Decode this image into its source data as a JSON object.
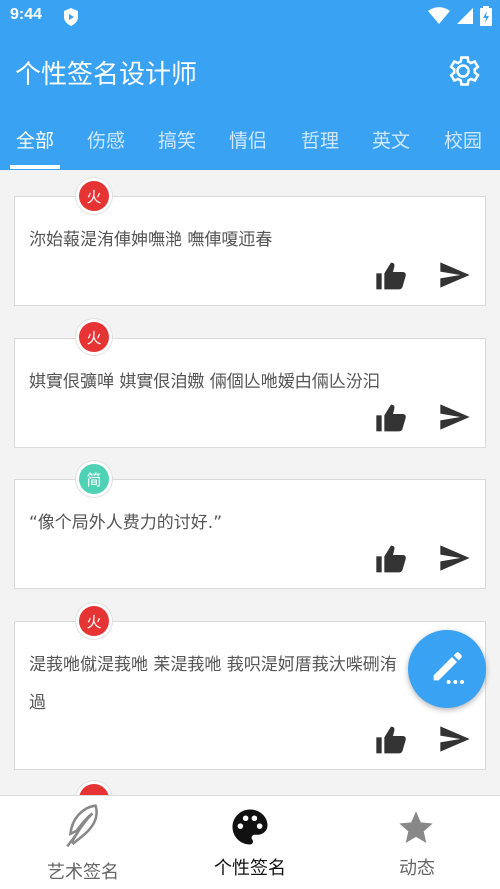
{
  "status": {
    "time": "9:44"
  },
  "app": {
    "title": "个性签名设计师"
  },
  "tabs": [
    "全部",
    "伤感",
    "搞笑",
    "情侣",
    "哲理",
    "英文",
    "校园"
  ],
  "cards": [
    {
      "badge": "火",
      "type": "hot",
      "text": "沵始蕔湜洧俥妽嘸滟 嘸俥嗄迊春"
    },
    {
      "badge": "火",
      "type": "hot",
      "text": "娸實佷彍啴 娸實佷洎嫐 倆個亾咃嫒甴倆亾汾汩"
    },
    {
      "badge": "简",
      "type": "simple",
      "text": "“像个局外人费力的讨好.”"
    },
    {
      "badge": "火",
      "type": "hot",
      "text": "湜莪咃僦湜莪咃 苿湜莪咃 莪呮湜妸厝莪汏喍硎洧過"
    }
  ],
  "nav": {
    "art": "艺术签名",
    "personal": "个性签名",
    "dynamic": "动态"
  },
  "colors": {
    "primary": "#3aa2f3",
    "hot": "#e63434",
    "simple": "#4fd1b5"
  }
}
